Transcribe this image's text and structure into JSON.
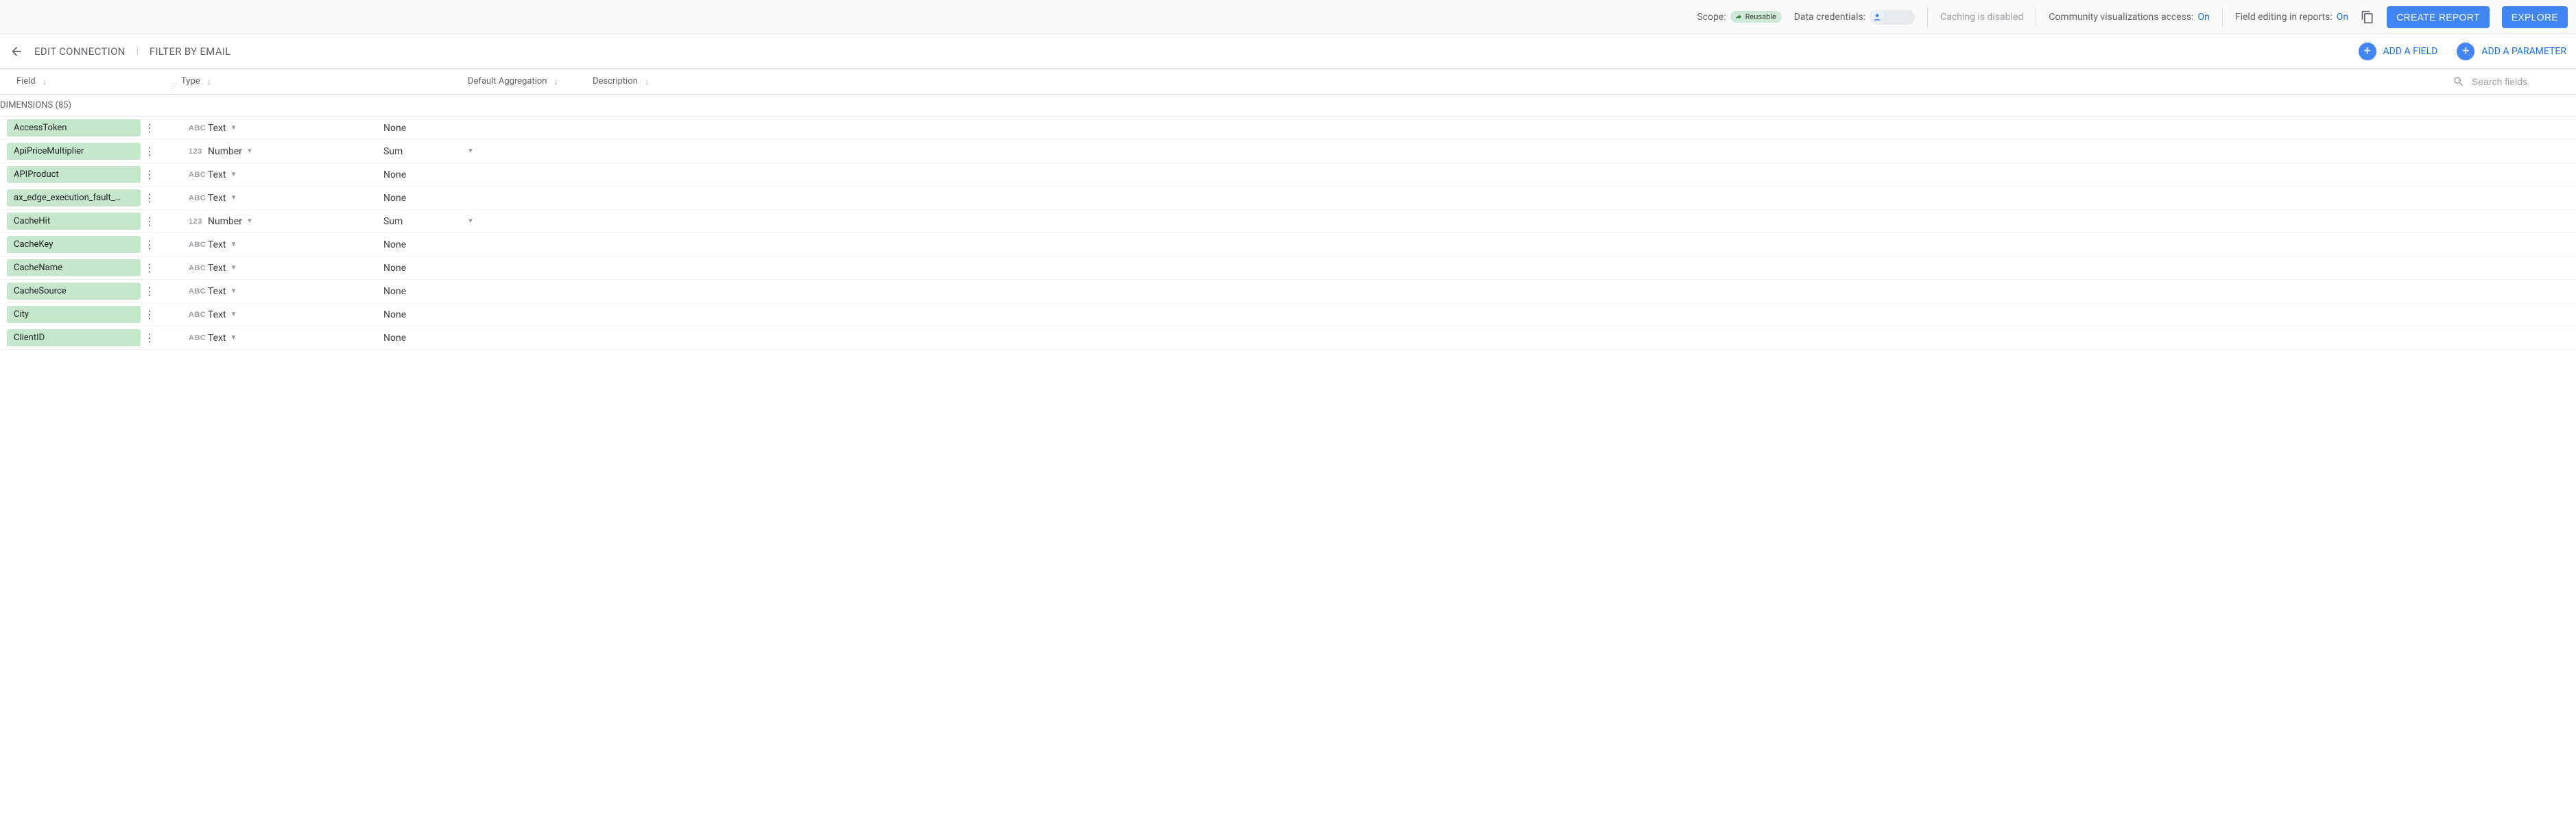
{
  "config_bar": {
    "scope_label": "Scope:",
    "scope_chip": "Reusable",
    "data_credentials_label": "Data credentials:",
    "caching_label": "Caching is disabled",
    "community_viz_label": "Community visualizations access:",
    "community_viz_value": "On",
    "field_editing_label": "Field editing in reports:",
    "field_editing_value": "On",
    "create_report_btn": "CREATE REPORT",
    "explore_btn": "EXPLORE"
  },
  "nav_bar": {
    "edit_connection": "EDIT CONNECTION",
    "filter_by_email": "FILTER BY EMAIL",
    "add_field": "ADD A FIELD",
    "add_parameter": "ADD A PARAMETER"
  },
  "columns": {
    "field": "Field",
    "type": "Type",
    "aggregation": "Default Aggregation",
    "description": "Description",
    "search_placeholder": "Search fields"
  },
  "group_header": "DIMENSIONS (85)",
  "rows": [
    {
      "name": "AccessToken",
      "type_icon": "ABC",
      "type": "Text",
      "agg": "None",
      "agg_dropdown": false
    },
    {
      "name": "ApiPriceMultiplier",
      "type_icon": "123",
      "type": "Number",
      "agg": "Sum",
      "agg_dropdown": true
    },
    {
      "name": "APIProduct",
      "type_icon": "ABC",
      "type": "Text",
      "agg": "None",
      "agg_dropdown": false
    },
    {
      "name": "ax_edge_execution_fault_…",
      "type_icon": "ABC",
      "type": "Text",
      "agg": "None",
      "agg_dropdown": false
    },
    {
      "name": "CacheHit",
      "type_icon": "123",
      "type": "Number",
      "agg": "Sum",
      "agg_dropdown": true
    },
    {
      "name": "CacheKey",
      "type_icon": "ABC",
      "type": "Text",
      "agg": "None",
      "agg_dropdown": false
    },
    {
      "name": "CacheName",
      "type_icon": "ABC",
      "type": "Text",
      "agg": "None",
      "agg_dropdown": false
    },
    {
      "name": "CacheSource",
      "type_icon": "ABC",
      "type": "Text",
      "agg": "None",
      "agg_dropdown": false
    },
    {
      "name": "City",
      "type_icon": "ABC",
      "type": "Text",
      "agg": "None",
      "agg_dropdown": false
    },
    {
      "name": "ClientID",
      "type_icon": "ABC",
      "type": "Text",
      "agg": "None",
      "agg_dropdown": false
    }
  ]
}
